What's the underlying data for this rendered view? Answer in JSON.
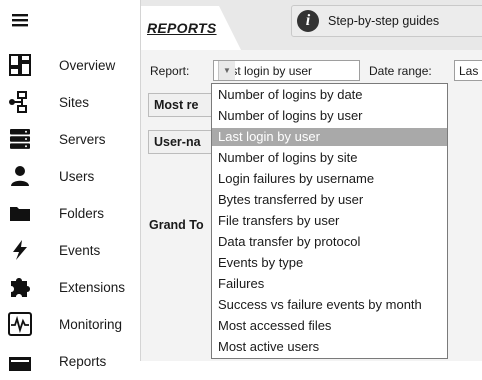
{
  "sidebar": {
    "menu_icon": "hamburger-icon",
    "items": [
      {
        "label": "Overview",
        "icon": "dashboard-icon"
      },
      {
        "label": "Sites",
        "icon": "sites-network-icon"
      },
      {
        "label": "Servers",
        "icon": "servers-icon"
      },
      {
        "label": "Users",
        "icon": "user-icon"
      },
      {
        "label": "Folders",
        "icon": "folder-icon"
      },
      {
        "label": "Events",
        "icon": "lightning-icon"
      },
      {
        "label": "Extensions",
        "icon": "puzzle-icon"
      },
      {
        "label": "Monitoring",
        "icon": "monitor-pulse-icon"
      },
      {
        "label": "Reports",
        "icon": "reports-icon"
      }
    ]
  },
  "header": {
    "tab_title": "REPORTS",
    "guide_button": "Step-by-step guides"
  },
  "report_bar": {
    "report_label": "Report:",
    "report_value": "Last login by user",
    "date_range_label": "Date range:",
    "date_range_value": "Las"
  },
  "boxes": {
    "most_re": "Most re",
    "user_na": "User-na",
    "grand_to": "Grand To"
  },
  "dropdown": {
    "selected_index": 2,
    "options": [
      "Number of logins by date",
      "Number of logins by user",
      "Last login by user",
      "Number of logins by site",
      "Login failures by username",
      "Bytes transferred by user",
      "File transfers by user",
      "Data transfer by protocol",
      "Events by type",
      "Failures",
      "Success vs failure events by month",
      "Most accessed files",
      "Most active users"
    ]
  }
}
